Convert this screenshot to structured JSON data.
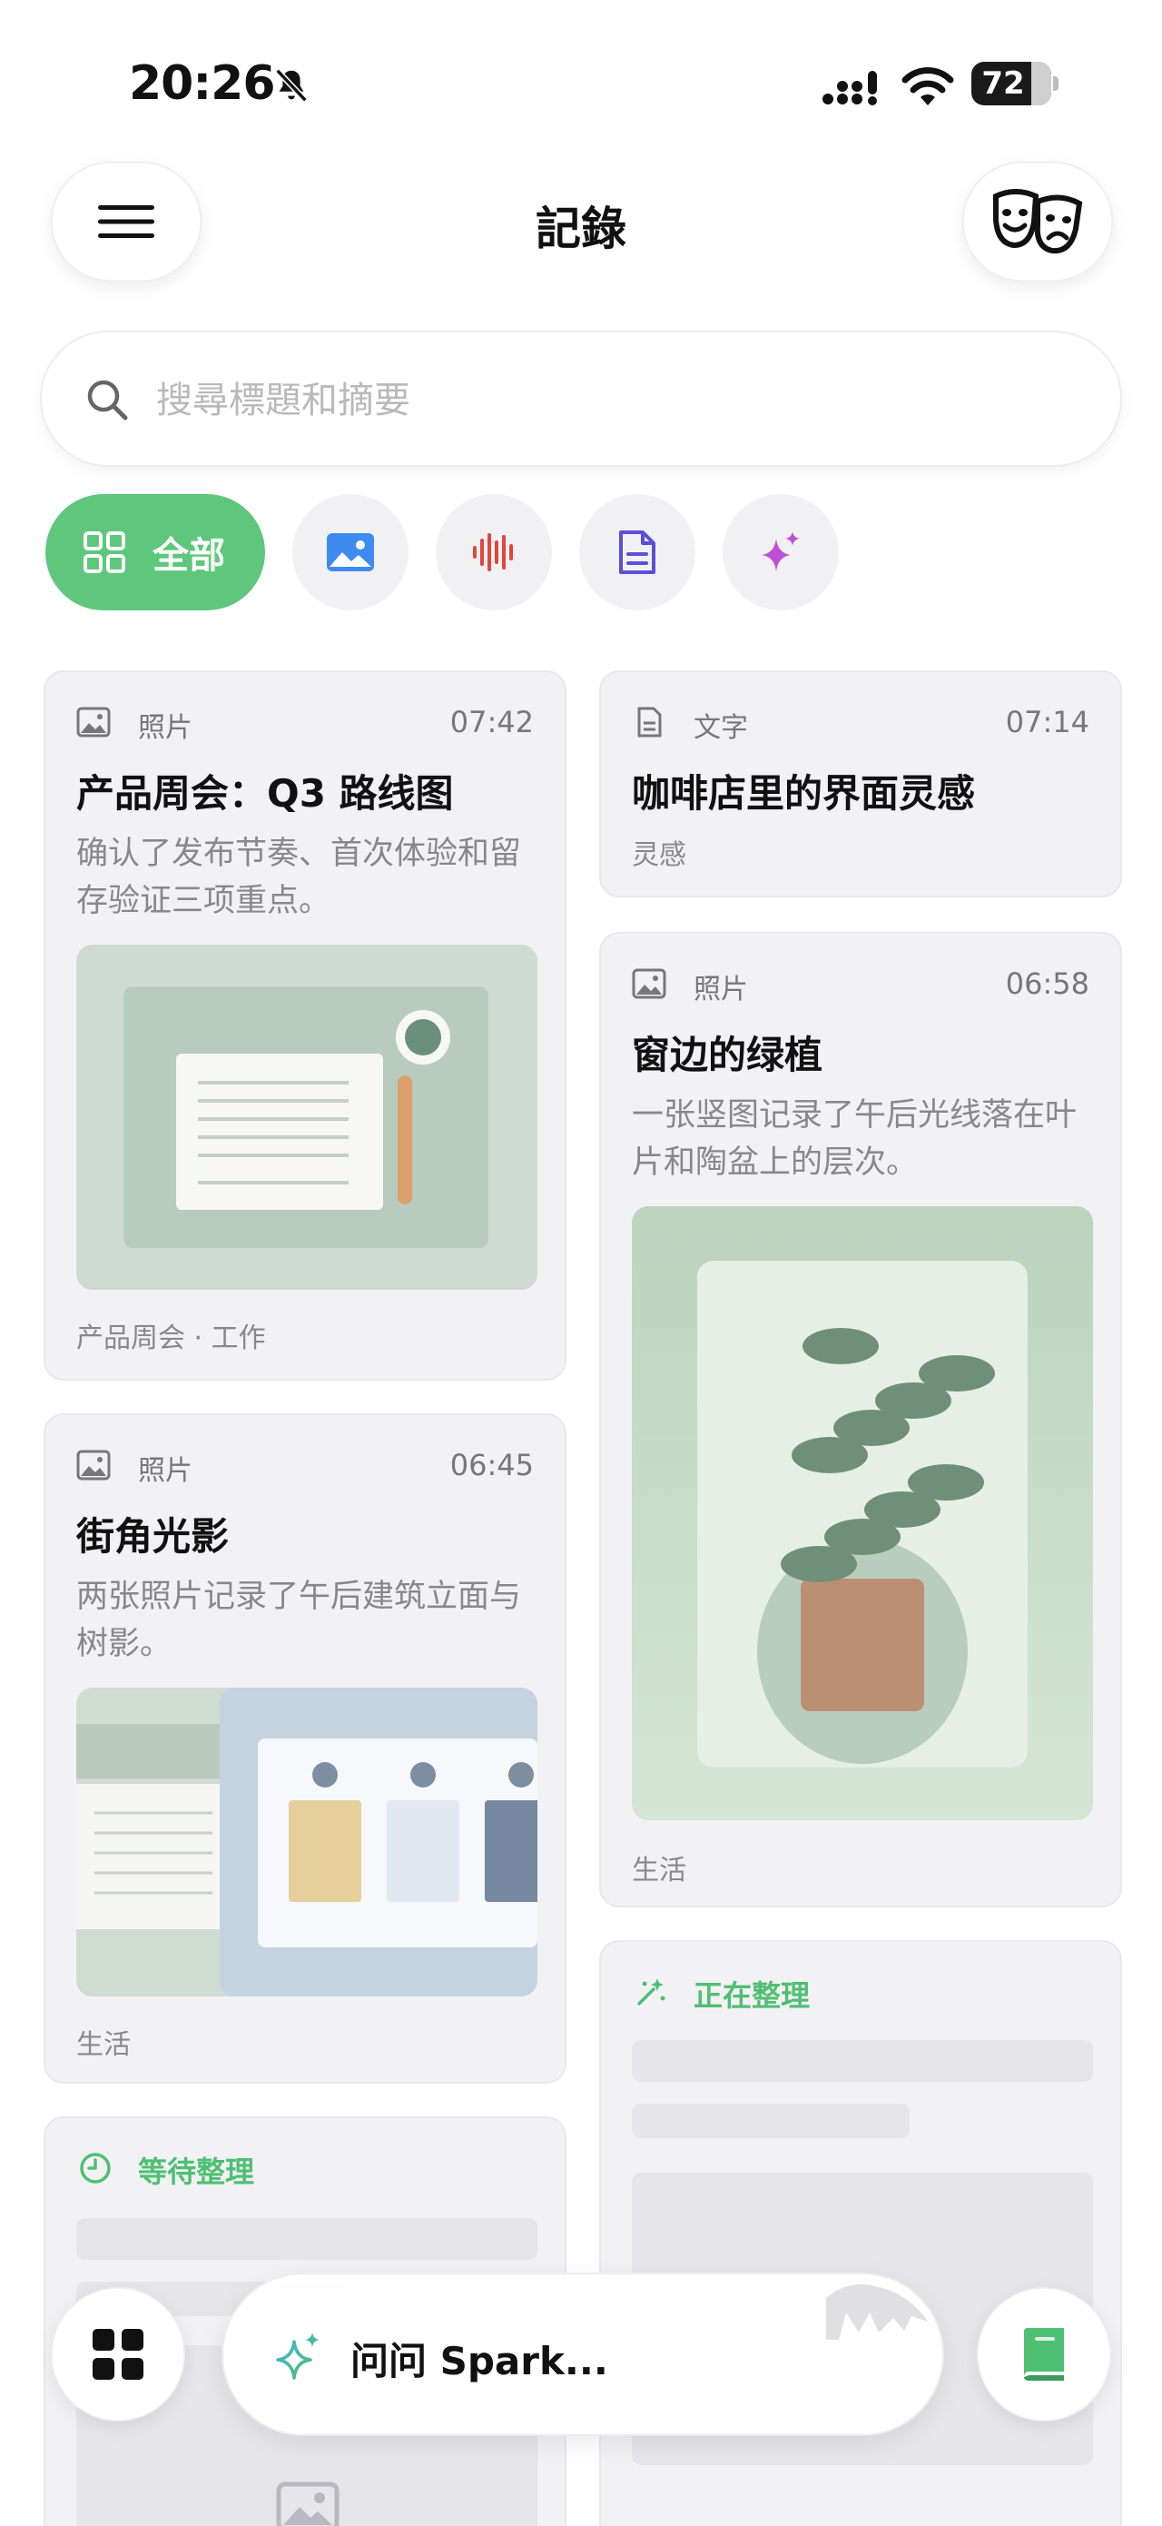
{
  "status_bar": {
    "time": "20:26",
    "battery": "72"
  },
  "header": {
    "title": "記錄"
  },
  "search": {
    "placeholder": "搜尋標題和摘要"
  },
  "filters": {
    "all_label": "全部",
    "chips": [
      "image-filter",
      "audio-filter",
      "document-filter",
      "sparkle-filter"
    ]
  },
  "cards": {
    "c1": {
      "type": "照片",
      "time": "07:42",
      "title": "产品周会：Q3 路线图",
      "desc": "确认了发布节奏、首次体验和留存验证三项重点。",
      "tag": "产品周会 · 工作"
    },
    "c2": {
      "type": "文字",
      "time": "07:14",
      "title": "咖啡店里的界面灵感",
      "tag": "灵感"
    },
    "c3": {
      "type": "照片",
      "time": "06:58",
      "title": "窗边的绿植",
      "desc": "一张竖图记录了午后光线落在叶片和陶盆上的层次。",
      "tag": "生活"
    },
    "c4": {
      "type": "照片",
      "time": "06:45",
      "title": "街角光影",
      "desc": "两张照片记录了午后建筑立面与树影。",
      "tag": "生活"
    },
    "c5": {
      "status": "正在整理"
    },
    "c6": {
      "status": "等待整理"
    }
  },
  "bottom": {
    "ask_label": "问问 Spark..."
  },
  "colors": {
    "accent": "#5ec77c",
    "card_bg": "#f2f2f5",
    "text_muted": "#888888"
  }
}
